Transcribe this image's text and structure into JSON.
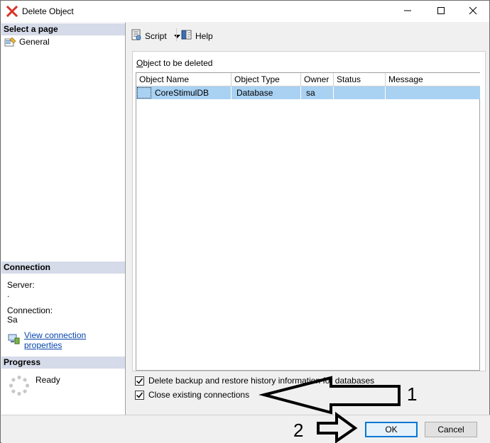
{
  "window": {
    "title": "Delete Object",
    "title_icon": "red-x-icon",
    "controls": {
      "minimize": "minimize-icon",
      "maximize": "maximize-icon",
      "close": "close-icon"
    }
  },
  "left_pane": {
    "select_page_header": "Select a page",
    "pages": [
      {
        "label": "General",
        "icon": "page-general-icon"
      }
    ],
    "connection_header": "Connection",
    "server_label": "Server:",
    "server_value": ".",
    "connection_label": "Connection:",
    "connection_value": "Sa",
    "view_connection_link": "View connection properties",
    "progress_header": "Progress",
    "progress_status": "Ready"
  },
  "toolbar": {
    "script_label": "Script",
    "help_label": "Help"
  },
  "content": {
    "objects_label_first": "O",
    "objects_label_rest": "bject to be deleted",
    "columns": [
      "Object Name",
      "Object Type",
      "Owner",
      "Status",
      "Message"
    ],
    "rows": [
      {
        "object_name": "CoreStimulDB",
        "object_type": "Database",
        "owner": "sa",
        "status": "",
        "message": ""
      }
    ],
    "checkbox_backup": {
      "label": "Delete backup and restore history information for databases",
      "checked": true
    },
    "checkbox_close": {
      "label": "Close existing connections",
      "checked": true
    }
  },
  "footer": {
    "ok_label": "OK",
    "cancel_label": "Cancel"
  },
  "annotations": {
    "marker_1": "1",
    "marker_2": "2"
  },
  "colors": {
    "selected_row": "#a9d1f2",
    "section_header": "#d6dbe9",
    "link": "#0645ad",
    "ok_border": "#0078d7",
    "title_icon": "#d9342b"
  }
}
